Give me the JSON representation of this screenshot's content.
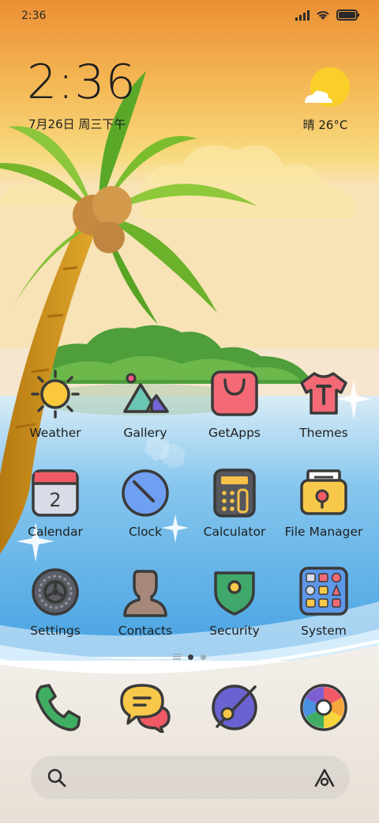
{
  "status_bar": {
    "time": "2:36",
    "signal_icon": "signal-icon",
    "wifi_icon": "wifi-icon",
    "battery_icon": "battery-icon"
  },
  "clock_widget": {
    "time": "2:36",
    "date": "7月26日 周三下午"
  },
  "weather_widget": {
    "icon": "sun-cloud-icon",
    "text": "晴 26°C"
  },
  "apps": [
    {
      "label": "Weather",
      "icon": "weather-icon"
    },
    {
      "label": "Gallery",
      "icon": "gallery-icon"
    },
    {
      "label": "GetApps",
      "icon": "getapps-icon"
    },
    {
      "label": "Themes",
      "icon": "themes-icon"
    },
    {
      "label": "Calendar",
      "icon": "calendar-icon",
      "day": "2"
    },
    {
      "label": "Clock",
      "icon": "clock-icon"
    },
    {
      "label": "Calculator",
      "icon": "calculator-icon"
    },
    {
      "label": "File Manager",
      "icon": "file-manager-icon"
    },
    {
      "label": "Settings",
      "icon": "settings-icon"
    },
    {
      "label": "Contacts",
      "icon": "contacts-icon"
    },
    {
      "label": "Security",
      "icon": "security-icon"
    },
    {
      "label": "System",
      "icon": "system-folder-icon"
    }
  ],
  "page_indicator": {
    "pages": 2,
    "current": 1
  },
  "dock": [
    {
      "icon": "phone-icon"
    },
    {
      "icon": "messages-icon"
    },
    {
      "icon": "browser-icon"
    },
    {
      "icon": "camera-icon"
    }
  ],
  "search_bar": {
    "search_icon": "search-icon",
    "assistant_icon": "assistant-icon"
  },
  "colors": {
    "sky_top": "#ef9a3a",
    "sky_mid": "#f8d36a",
    "sea": "#5aaee8",
    "sand": "#ece6de",
    "icon_outline": "#3a3a3a"
  }
}
